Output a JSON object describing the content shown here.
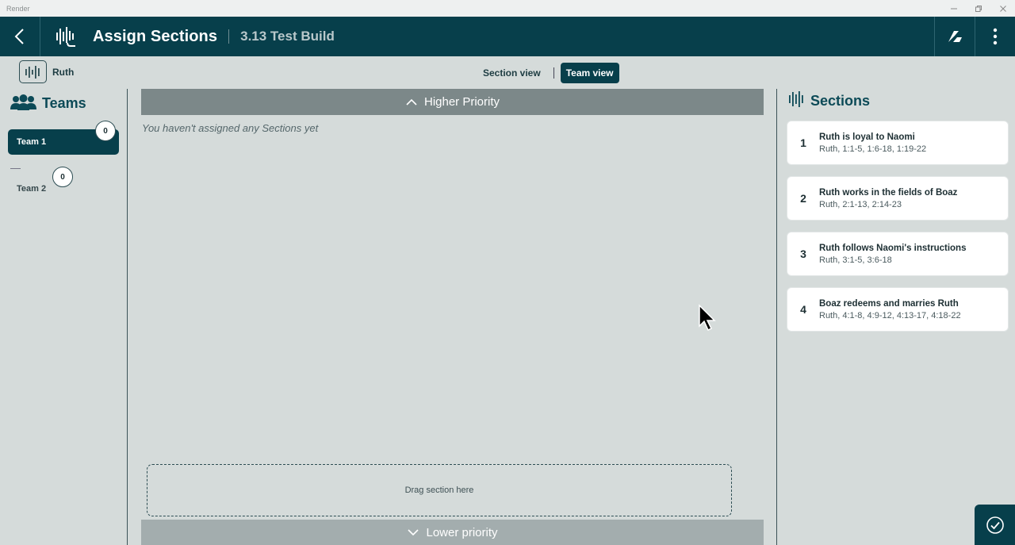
{
  "window": {
    "app_name": "Render"
  },
  "header": {
    "title": "Assign Sections",
    "subtitle": "3.13 Test Build"
  },
  "project": {
    "name": "Ruth"
  },
  "view_toggle": {
    "options": [
      "Section view",
      "Team view"
    ],
    "active": "Team view"
  },
  "teams": {
    "title": "Teams",
    "items": [
      {
        "label": "Team 1",
        "count": "0",
        "selected": true
      },
      {
        "label": "Team 2",
        "count": "0",
        "selected": false
      }
    ]
  },
  "center": {
    "higher_priority": "Higher Priority",
    "empty_message": "You haven't assigned any Sections yet",
    "drop_zone": "Drag section here",
    "lower_priority": "Lower priority"
  },
  "sections": {
    "title": "Sections",
    "items": [
      {
        "number": "1",
        "title": "Ruth is loyal to Naomi",
        "ref": "Ruth, 1:1-5, 1:6-18, 1:19-22"
      },
      {
        "number": "2",
        "title": "Ruth works in the fields of Boaz",
        "ref": "Ruth, 2:1-13, 2:14-23"
      },
      {
        "number": "3",
        "title": "Ruth follows Naomi's instructions",
        "ref": "Ruth, 3:1-5, 3:6-18"
      },
      {
        "number": "4",
        "title": "Boaz redeems and marries Ruth",
        "ref": "Ruth, 4:1-8, 4:9-12, 4:13-17, 4:18-22"
      }
    ]
  },
  "colors": {
    "primary": "#073f4b",
    "background": "#d5dbda",
    "priority_bar": "#7c8889"
  },
  "icons": [
    "back-arrow-icon",
    "waveform-logo-icon",
    "sync-icon",
    "more-vert-icon",
    "audio-project-icon",
    "teams-icon",
    "sections-waveform-icon",
    "chevron-up-icon",
    "chevron-down-icon",
    "checkmark-icon"
  ]
}
